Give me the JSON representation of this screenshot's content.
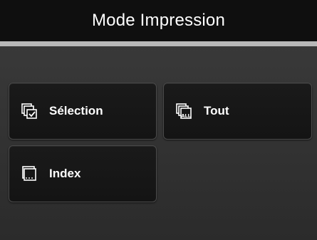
{
  "header": {
    "title": "Mode Impression"
  },
  "menu": {
    "items": [
      {
        "label": "Sélection",
        "icon": "select-images-icon"
      },
      {
        "label": "Tout",
        "icon": "all-images-icon"
      },
      {
        "label": "Index",
        "icon": "index-print-icon"
      }
    ]
  },
  "colors": {
    "header_background": "#0f0f0f",
    "divider": "#b8b8b8",
    "tile_background": "#161616",
    "text": "#ffffff"
  }
}
